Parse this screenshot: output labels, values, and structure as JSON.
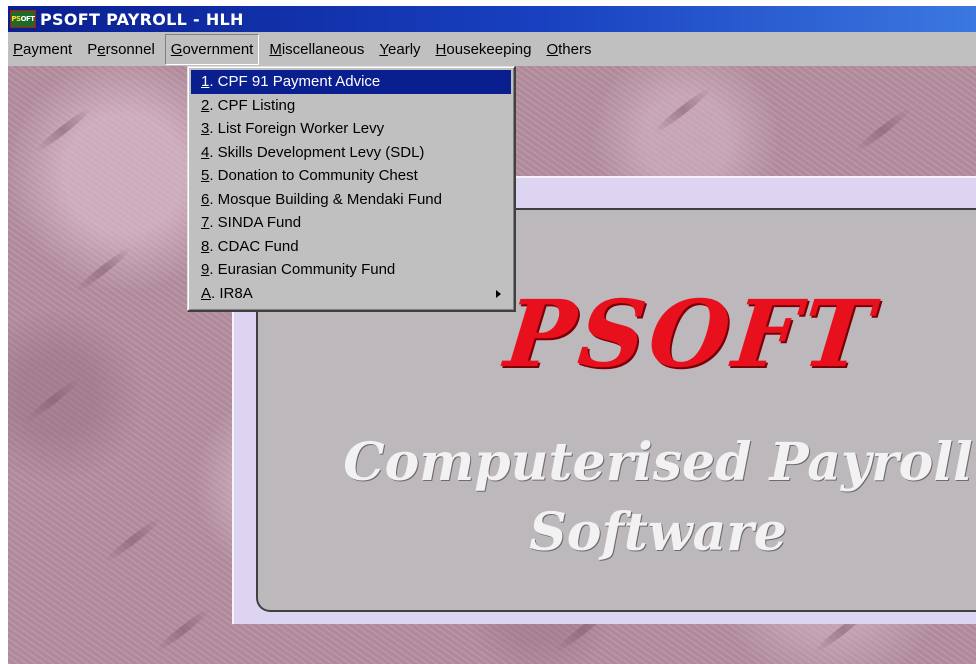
{
  "window": {
    "title": "PSOFT PAYROLL - HLH",
    "icon_text_a": "PS",
    "icon_text_b": "OFT"
  },
  "menubar": {
    "items": [
      {
        "key": "P",
        "rest": "ayment"
      },
      {
        "key": "",
        "pre": "P",
        "u": "e",
        "rest": "rsonnel"
      },
      {
        "key": "G",
        "rest": "overnment"
      },
      {
        "key": "M",
        "rest": "iscellaneous"
      },
      {
        "key": "Y",
        "rest": "early"
      },
      {
        "key": "H",
        "rest": "ousekeeping"
      },
      {
        "key": "O",
        "rest": "thers"
      }
    ],
    "active": "Government"
  },
  "dropdown": {
    "items": [
      {
        "key": "1",
        "rest": ". CPF 91 Payment Advice",
        "selected": true
      },
      {
        "key": "2",
        "rest": ". CPF Listing"
      },
      {
        "key": "3",
        "rest": ". List Foreign Worker Levy"
      },
      {
        "key": "4",
        "rest": ". Skills Development Levy (SDL)"
      },
      {
        "key": "5",
        "rest": ". Donation to Community Chest"
      },
      {
        "key": "6",
        "rest": ". Mosque Building & Mendaki Fund"
      },
      {
        "key": "7",
        "rest": ". SINDA Fund"
      },
      {
        "key": "8",
        "rest": ". CDAC Fund"
      },
      {
        "key": "9",
        "rest": ". Eurasian Community Fund"
      },
      {
        "key": "A",
        "rest": ". IR8A",
        "submenu": true
      }
    ]
  },
  "splash": {
    "logo": "PSOFT",
    "tagline_line1": "Computerised Payroll",
    "tagline_line2": "Software"
  },
  "colors": {
    "titlebar": "#0a1f8f",
    "menu_bg": "#c0c0c0",
    "selection": "#0a1f8f",
    "logo_red": "#e8101c",
    "desktop": "#b58fa0"
  }
}
